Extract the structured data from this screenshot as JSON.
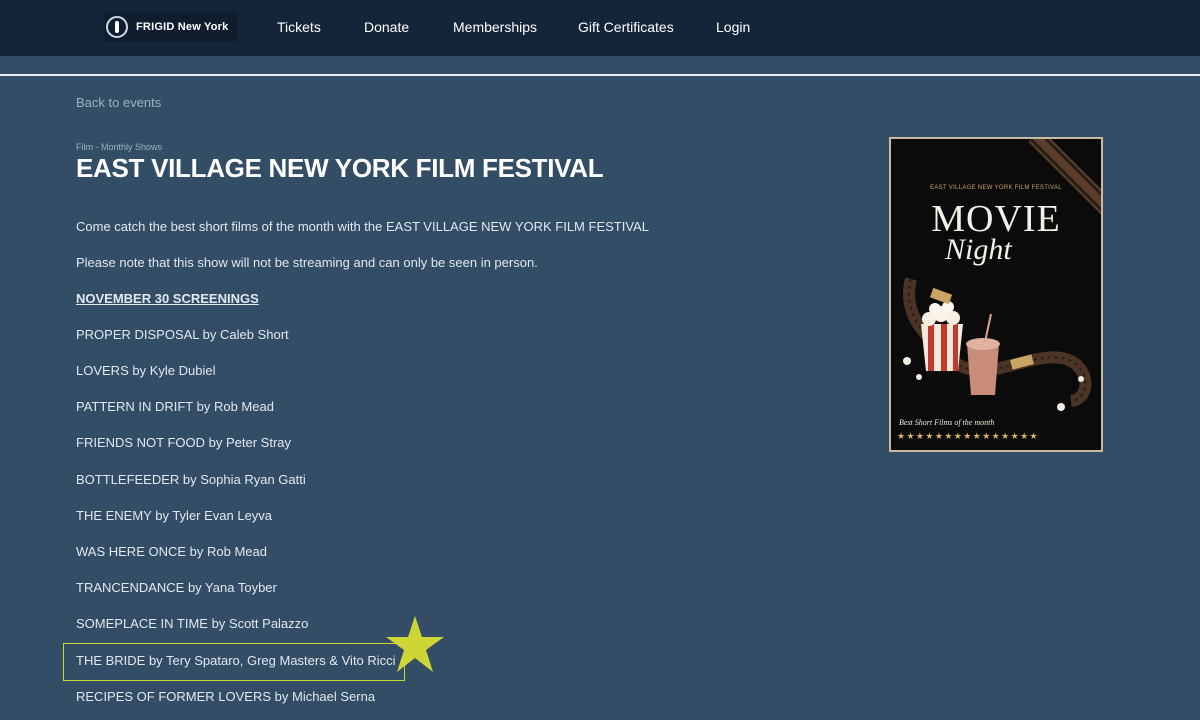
{
  "header": {
    "logo_text": "FRIGID New York",
    "nav": {
      "tickets": "Tickets",
      "donate": "Donate",
      "memberships": "Memberships",
      "gift_certificates": "Gift Certificates",
      "login": "Login"
    }
  },
  "back_link": "Back to events",
  "event": {
    "category": "Film - Monthly Shows",
    "title": "EAST VILLAGE NEW YORK FILM FESTIVAL",
    "intro": [
      "Come catch the best short films of the month with the EAST VILLAGE NEW YORK FILM FESTIVAL",
      "Please note that this show will not be streaming and can only be seen in person."
    ],
    "screenings_heading": "NOVEMBER 30 SCREENINGS",
    "films": [
      "PROPER DISPOSAL by Caleb Short",
      "LOVERS by Kyle Dubiel",
      "PATTERN IN DRIFT by Rob Mead",
      "FRIENDS NOT FOOD by  Peter Stray",
      "BOTTLEFEEDER by Sophia Ryan Gatti",
      "THE ENEMY by Tyler Evan Leyva",
      "WAS HERE ONCE by Rob Mead",
      "TRANCENDANCE by Yana Toyber",
      "SOMEPLACE IN TIME by Scott Palazzo",
      "THE BRIDE by Tery Spataro, Greg Masters & Vito Ricci",
      "RECIPES OF FORMER LOVERS by Michael Serna"
    ],
    "highlighted_film_index": 9
  },
  "poster": {
    "header": "EAST VILLAGE NEW YORK FILM FESTIVAL",
    "title_line1": "MOVIE",
    "title_line2": "Night",
    "tagline": "Best Short Films of the month",
    "stars": "★★★★★★★★★★★★★★★"
  },
  "colors": {
    "page_bg": "#334d66",
    "nav_bg": "#14253a",
    "highlight": "#cdd634"
  }
}
